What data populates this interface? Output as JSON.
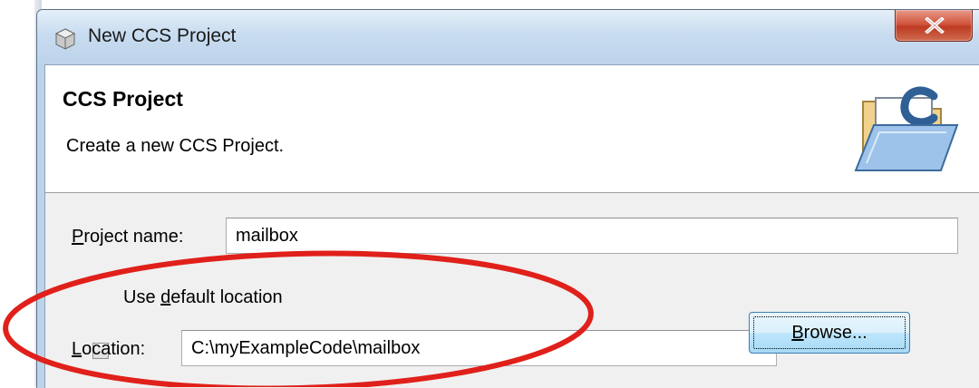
{
  "window": {
    "title": "New CCS Project"
  },
  "banner": {
    "title": "CCS Project",
    "description": "Create a new CCS Project."
  },
  "form": {
    "project_name": {
      "label_accel": "P",
      "label_rest": "roject name:",
      "value": "mailbox"
    },
    "use_default_location": {
      "label_before": "Use ",
      "label_accel": "d",
      "label_after": "efault location",
      "checked": false
    },
    "location": {
      "label_accel": "L",
      "label_rest": "ocation:",
      "value": "C:\\myExampleCode\\mailbox"
    },
    "browse": {
      "label_accel": "B",
      "label_rest": "rowse..."
    }
  },
  "annotation": {
    "color": "#e0201a"
  },
  "colors": {
    "close_button": "#c9472e",
    "titlebar": "#bcd3ea"
  }
}
